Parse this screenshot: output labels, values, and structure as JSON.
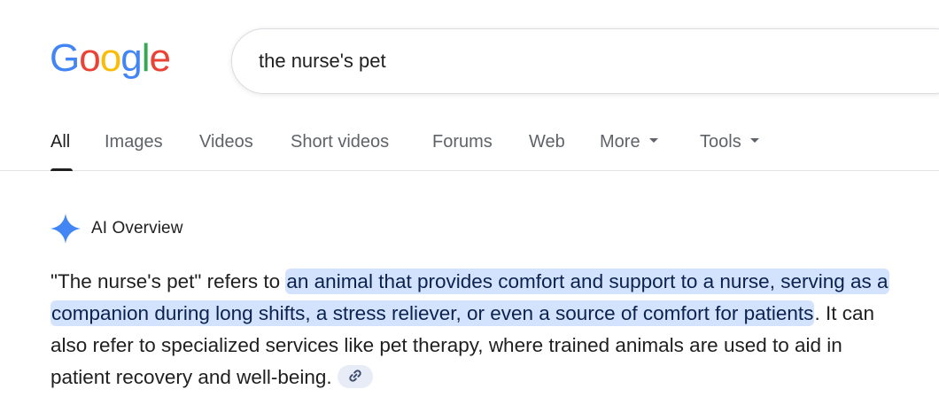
{
  "logo": {
    "letters": [
      "G",
      "o",
      "o",
      "g",
      "l",
      "e"
    ],
    "colors": [
      "#4285F4",
      "#EA4335",
      "#FBBC05",
      "#4285F4",
      "#34A853",
      "#EA4335"
    ]
  },
  "search": {
    "query": "the nurse's pet"
  },
  "tabs": [
    {
      "label": "All",
      "active": true
    },
    {
      "label": "Images"
    },
    {
      "label": "Videos"
    },
    {
      "label": "Short videos"
    },
    {
      "label": "Forums"
    },
    {
      "label": "Web"
    },
    {
      "label": "More"
    },
    {
      "label": "Tools"
    }
  ],
  "ai_overview": {
    "title": "AI Overview",
    "icon": "sparkle-icon",
    "accent_color": "#4285F4",
    "text_before": "\"The nurse's pet\" refers to ",
    "highlighted": "an animal that provides comfort and support to a nurse, serving as a companion during long shifts, a stress reliever, or even a source of comfort for patients",
    "text_after": ". It can also refer to specialized services like pet therapy, where trained animals are used to aid in patient recovery and well-being.",
    "highlight_color": "#d3e3fd",
    "link_icon": "link-icon"
  }
}
